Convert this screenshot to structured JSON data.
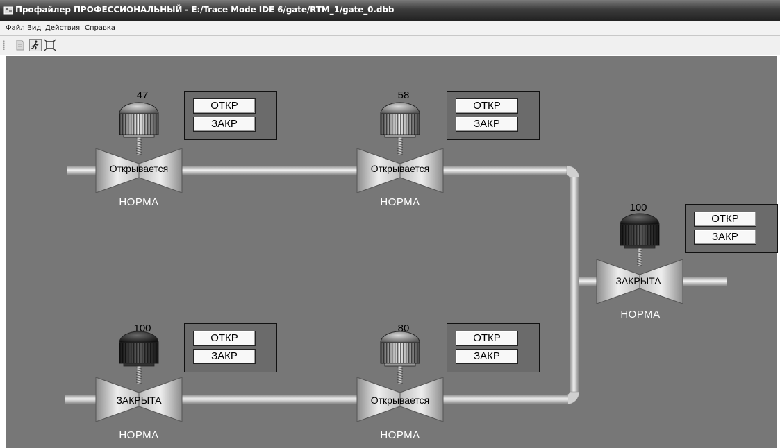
{
  "window": {
    "title": "Профайлер ПРОФЕССИОНАЛЬНЫЙ - E:/Trace Mode IDE 6/gate/RTM_1/gate_0.dbb"
  },
  "menu": {
    "items": [
      {
        "label": "Файл"
      },
      {
        "label": "Вид"
      },
      {
        "label": "Действия"
      },
      {
        "label": "Справка"
      }
    ]
  },
  "toolbar": {
    "icons": [
      "document-icon",
      "run-icon",
      "fullscreen-icon"
    ]
  },
  "colors": {
    "canvas": "#777777",
    "pipe": "#cfcfcf",
    "valve_body": "#c8c8c8",
    "status_text": "#ffffff"
  },
  "valves": [
    {
      "value": "47",
      "state": "Открывается",
      "status": "НОРМА",
      "btn_open": "ОТКР",
      "btn_close": "ЗАКР",
      "actuator": "open"
    },
    {
      "value": "58",
      "state": "Открывается",
      "status": "НОРМА",
      "btn_open": "ОТКР",
      "btn_close": "ЗАКР",
      "actuator": "open"
    },
    {
      "value": "100",
      "state": "ЗАКРЫТА",
      "status": "НОРМА",
      "btn_open": "ОТКР",
      "btn_close": "ЗАКР",
      "actuator": "closed"
    },
    {
      "value": "100",
      "state": "ЗАКРЫТА",
      "status": "НОРМА",
      "btn_open": "ОТКР",
      "btn_close": "ЗАКР",
      "actuator": "closed"
    },
    {
      "value": "80",
      "state": "Открывается",
      "status": "НОРМА",
      "btn_open": "ОТКР",
      "btn_close": "ЗАКР",
      "actuator": "open"
    }
  ]
}
